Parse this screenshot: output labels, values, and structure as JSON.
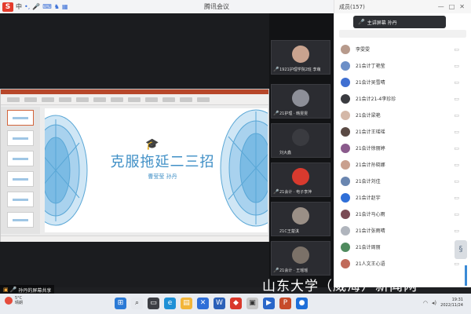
{
  "titlebar": {
    "ime_logo": "S",
    "ime_lang": "中",
    "app_title": "腾讯会议",
    "controls": {
      "minimize": "—",
      "maximize": "□",
      "close": "✕"
    }
  },
  "stage": {
    "slide": {
      "title": "克服拖延二三招",
      "subtitle": "曹莹莹  孙丹",
      "cap_icon": "graduation-cap-icon"
    },
    "self_tag": "孙丹的屏幕共享"
  },
  "video_tiles": [
    {
      "name": "1921护理学院2班 李萌"
    },
    {
      "name": "21护理 · 韩雯雯"
    },
    {
      "name": "刘大鑫"
    },
    {
      "name": "21会计 · 电子李萍"
    },
    {
      "name": "21C王楚淇"
    },
    {
      "name": "21会计 · 王瑶瑶"
    }
  ],
  "members": {
    "header": "成员(157)",
    "toast": "主讲屏幕 孙丹",
    "list": [
      {
        "name": "李雯雯"
      },
      {
        "name": "21会计丁艳莹"
      },
      {
        "name": "21会计吴雪晴"
      },
      {
        "name": "21会计21-4李珍珍"
      },
      {
        "name": "21会计梁艳"
      },
      {
        "name": "21会计王瑶瑶"
      },
      {
        "name": "21会计徐丽婷"
      },
      {
        "name": "21会计孙晓娜"
      },
      {
        "name": "21会计刘佳"
      },
      {
        "name": "21会计赵宇"
      },
      {
        "name": "21会计马心雨"
      },
      {
        "name": "21会计张雨晴"
      },
      {
        "name": "21会计周丽"
      },
      {
        "name": "21人文王心语"
      }
    ]
  },
  "watermark": "山东大学（威海）新闻网",
  "taskbar": {
    "weather_temp": "5°C",
    "weather_desc": "晴朗",
    "time": "19:31",
    "date": "2022/11/24"
  }
}
